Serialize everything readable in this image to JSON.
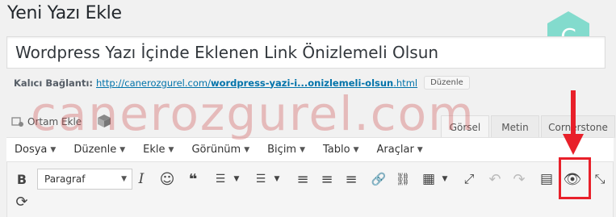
{
  "page": {
    "title": "Yeni Yazı Ekle"
  },
  "post": {
    "title": "Wordpress Yazı İçinde Eklenen Link Önizlemeli Olsun"
  },
  "permalink": {
    "label": "Kalıcı Bağlantı:",
    "url_prefix": "http://canerozgurel.com/",
    "url_slug": "wordpress-yazi-i...onizlemeli-olsun",
    "url_suffix": ".html",
    "edit_label": "Düzenle"
  },
  "media": {
    "add_label": "Ortam Ekle"
  },
  "tabs": {
    "visual": "Görsel",
    "text": "Metin",
    "cornerstone": "Cornerstone"
  },
  "menu": [
    {
      "label": "Dosya"
    },
    {
      "label": "Düzenle"
    },
    {
      "label": "Ekle"
    },
    {
      "label": "Görünüm"
    },
    {
      "label": "Biçim"
    },
    {
      "label": "Tablo"
    },
    {
      "label": "Araçlar"
    }
  ],
  "toolbar": {
    "format_value": "Paragraf",
    "bold": "B",
    "italic": "I",
    "emoji": "☺",
    "blockquote": "❝",
    "unordered_list": "☰",
    "ordered_list": "☰",
    "align_left": "≡",
    "align_center": "≡",
    "align_right": "≡",
    "link": "🔗",
    "unlink": "⛓",
    "table": "▦",
    "fullscreen": "⤢",
    "undo": "↶",
    "redo": "↷",
    "toolbar_toggle": "▤",
    "preview": "👁",
    "fullscreen2": "⤡",
    "refresh": "⟳"
  },
  "watermark": {
    "text": "canerozgurel.com"
  },
  "logo": {
    "letter": "C"
  },
  "colors": {
    "accent": "#0073aa",
    "highlight": "#e8202a",
    "logo": "#5ed3c0"
  }
}
